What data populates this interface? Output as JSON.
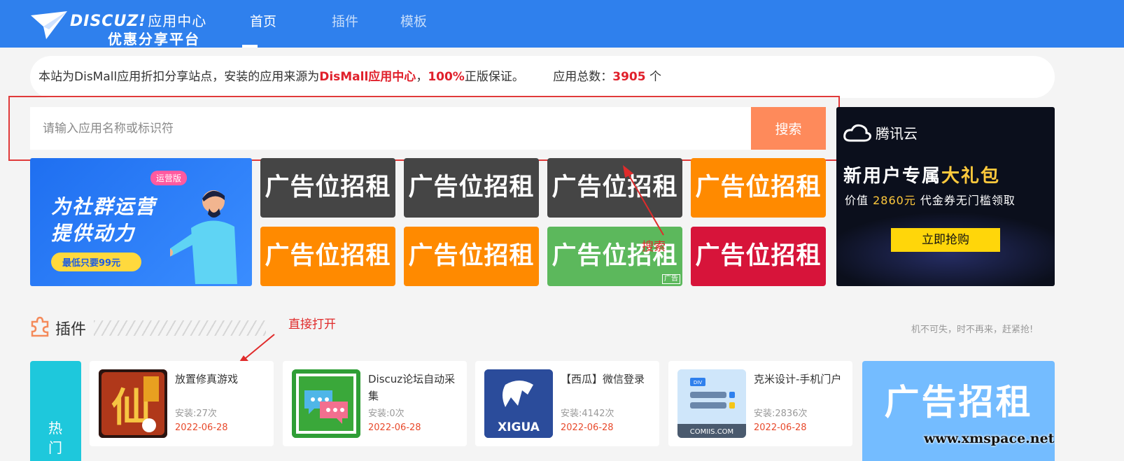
{
  "header": {
    "logo_brand": "DISCUZ!",
    "logo_sub": "应用中心",
    "logo_tag": "优惠分享平台",
    "nav": [
      {
        "label": "首页",
        "active": true
      },
      {
        "label": "插件",
        "active": false
      },
      {
        "label": "模板",
        "active": false
      }
    ],
    "bg_color": "#2f80ed"
  },
  "notice": {
    "prefix": "本站为DisMall应用折扣分享站点，安装的应用来源为",
    "source": "DisMall应用中心",
    "sep": "，",
    "percent": "100%",
    "suffix": "正版保证。",
    "total_label": "应用总数：",
    "total_value": "3905",
    "total_unit": " 个"
  },
  "search": {
    "placeholder": "请输入应用名称或标识符",
    "button_label": "搜索",
    "button_color": "#fe8a5b"
  },
  "tencent_ad": {
    "logo": "腾讯云",
    "line1_a": "新用户专属",
    "line1_b": "大礼包",
    "line2_a": "价值 ",
    "line2_b": "2860元",
    "line2_c": " 代金券无门槛领取",
    "button": "立即抢购"
  },
  "banner": {
    "badge": "运营版",
    "title1": "为社群运营",
    "title2": "提供动力",
    "price": "最低只要99元"
  },
  "ads": [
    {
      "label": "广告位招租",
      "color": "#454545"
    },
    {
      "label": "广告位招租",
      "color": "#454545"
    },
    {
      "label": "广告位招租",
      "color": "#454545"
    },
    {
      "label": "广告位招租",
      "color": "#ff8a00"
    },
    {
      "label": "广告位招租",
      "color": "#ff8a00"
    },
    {
      "label": "广告位招租",
      "color": "#ff8a00"
    },
    {
      "label": "广告位招租",
      "color": "#5cb85c",
      "mark": "广告"
    },
    {
      "label": "广告位招租",
      "color": "#d7143a"
    }
  ],
  "annotations": {
    "search_note": "搜索",
    "open_note": "直接打开"
  },
  "section": {
    "title": "插件",
    "note": "机不可失，时不再来，赶紧抢!",
    "hot_label": "热门"
  },
  "plugins": [
    {
      "name": "放置修真游戏",
      "installs": "安装:27次",
      "date": "2022-06-28",
      "icon": "xiuzhen-game-icon"
    },
    {
      "name": "Discuz论坛自动采集",
      "installs": "安装:0次",
      "date": "2022-06-28",
      "icon": "chat-bubbles-icon"
    },
    {
      "name": "【西瓜】微信登录",
      "installs": "安装:4142次",
      "date": "2022-06-28",
      "icon": "xigua-logo-icon"
    },
    {
      "name": "克米设计-手机门户",
      "installs": "安装:2836次",
      "date": "2022-06-28",
      "icon": "comiis-logo-icon"
    }
  ],
  "right_ad": {
    "label": "广告招租",
    "color": "#74bcff"
  },
  "watermark": "www.xmspace.net"
}
